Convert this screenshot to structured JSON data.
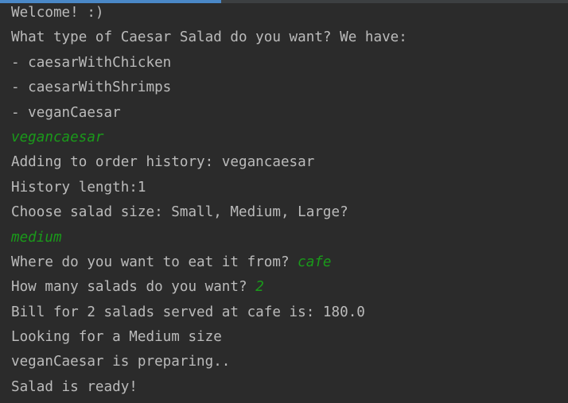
{
  "window": {
    "progress_fraction": 0.39,
    "accent_color": "#4a88c7",
    "background_color": "#2b2b2b",
    "text_color": "#bbbbbb",
    "input_color": "#1a9a1a"
  },
  "console": {
    "lines": [
      {
        "output": "Welcome! :)",
        "input": ""
      },
      {
        "output": "What type of Caesar Salad do you want? We have:",
        "input": ""
      },
      {
        "output": "- caesarWithChicken",
        "input": ""
      },
      {
        "output": "- caesarWithShrimps",
        "input": ""
      },
      {
        "output": "- veganCaesar",
        "input": ""
      },
      {
        "output": "",
        "input": "vegancaesar"
      },
      {
        "output": "Adding to order history: vegancaesar",
        "input": ""
      },
      {
        "output": "History length:1",
        "input": ""
      },
      {
        "output": "Choose salad size: Small, Medium, Large?",
        "input": ""
      },
      {
        "output": "",
        "input": "medium"
      },
      {
        "output": "Where do you want to eat it from? ",
        "input": "cafe"
      },
      {
        "output": "How many salads do you want? ",
        "input": "2"
      },
      {
        "output": "Bill for 2 salads served at cafe is: 180.0",
        "input": ""
      },
      {
        "output": "Looking for a Medium size",
        "input": ""
      },
      {
        "output": "veganCaesar is preparing..",
        "input": ""
      },
      {
        "output": "Salad is ready!",
        "input": ""
      }
    ]
  }
}
